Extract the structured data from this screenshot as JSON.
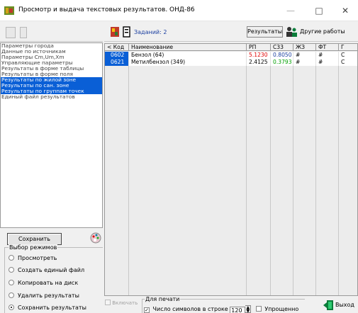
{
  "window": {
    "title": "Просмотр и выдача текстовых результатов. ОНД-86",
    "minimize_glyph": "—",
    "maximize_glyph": "□",
    "close_glyph": "✕"
  },
  "left_panel": {
    "items": [
      {
        "label": "Параметры города",
        "selected": false
      },
      {
        "label": "Данные по источникам",
        "selected": false
      },
      {
        "label": "Параметры Cm,Um,Xm",
        "selected": false
      },
      {
        "label": "Управляющие параметры",
        "selected": false
      },
      {
        "label": "Результаты в форме таблицы",
        "selected": false
      },
      {
        "label": "Результаты в форме поля",
        "selected": false
      },
      {
        "label": "Результаты по жилой зоне",
        "selected": true
      },
      {
        "label": "Результаты по сан. зоне",
        "selected": true
      },
      {
        "label": "Результаты по группам точек",
        "selected": true
      },
      {
        "label": "Единый файл результатов",
        "selected": false
      }
    ],
    "save_label": "Сохранить",
    "modes_legend": "Выбор режимов",
    "modes": [
      {
        "label": "Просмотреть",
        "checked": false
      },
      {
        "label": "Создать единый файл",
        "checked": false
      },
      {
        "label": "Копировать на диск",
        "checked": false
      },
      {
        "label": "Удалить результаты",
        "checked": false
      },
      {
        "label": "Сохранить результаты",
        "checked": true
      }
    ]
  },
  "toolbar": {
    "tasks_label": "Заданий: 2",
    "results_label": "Результаты",
    "other_label": "Другие работы"
  },
  "grid": {
    "columns": [
      "< Код",
      "Наименование",
      "РП",
      "С33",
      "ЖЗ",
      "ФТ",
      "Г"
    ],
    "rows": [
      {
        "code": "0602",
        "name": "Бензол (64)",
        "rp": "5.1230",
        "c33": "0.8050",
        "zhz": "#",
        "ft": "#",
        "g": "С"
      },
      {
        "code": "0621",
        "name": "Метилбензол (349)",
        "rp": "2.4125",
        "c33": "0.3793",
        "zhz": "#",
        "ft": "#",
        "g": "С"
      }
    ]
  },
  "bottom": {
    "include_label": "Включать",
    "print_legend": "Для печати",
    "chars_label": "Число символов в строке",
    "chars_value": "120",
    "simplified_label": "Упрощенно",
    "exit_label": "Выход"
  },
  "colors": {
    "selection": "#0a5fd6",
    "rp_value": "#e00000",
    "c33_value": "#00a000"
  }
}
